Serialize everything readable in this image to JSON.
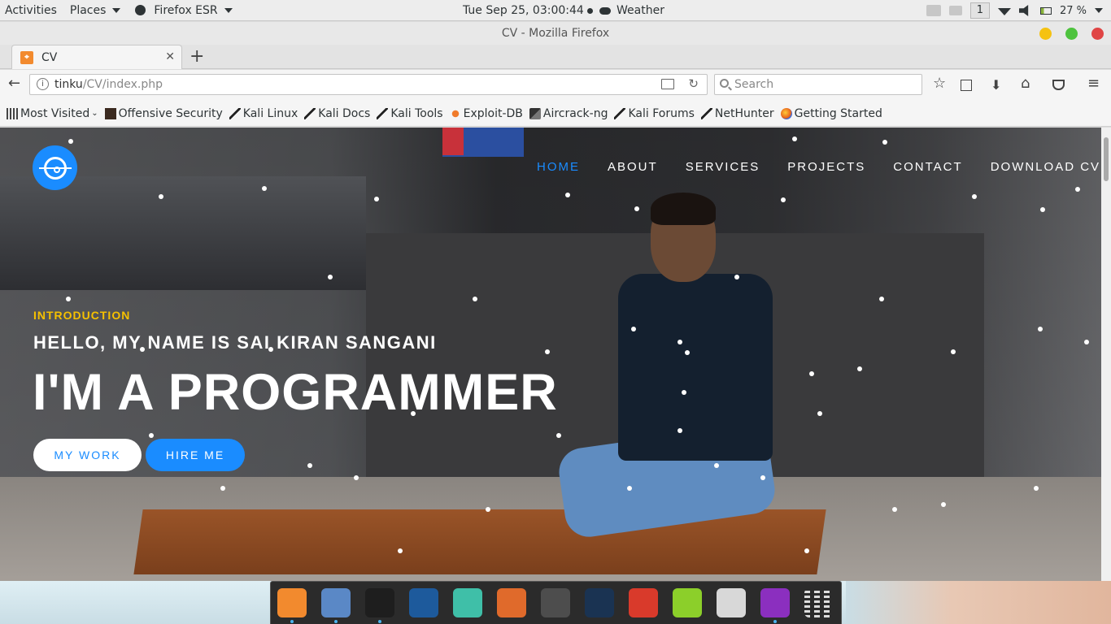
{
  "topbar": {
    "activities": "Activities",
    "places": "Places",
    "app_menu": "Firefox ESR",
    "clock": "Tue Sep 25, 03:00:44",
    "weather": "Weather",
    "workspace": "1",
    "battery": "27 %"
  },
  "window": {
    "title": "CV - Mozilla Firefox"
  },
  "tabs": [
    {
      "label": "CV"
    }
  ],
  "navbar": {
    "url_host": "tinku",
    "url_path": "/CV/index.php",
    "search_placeholder": "Search"
  },
  "bookmarks": [
    {
      "label": "Most Visited",
      "icon": "most-visited-icon"
    },
    {
      "label": "Offensive Security",
      "icon": "offsec-icon"
    },
    {
      "label": "Kali Linux",
      "icon": "kali-icon"
    },
    {
      "label": "Kali Docs",
      "icon": "kali-icon"
    },
    {
      "label": "Kali Tools",
      "icon": "kali-icon"
    },
    {
      "label": "Exploit-DB",
      "icon": "exploit-db-icon"
    },
    {
      "label": "Aircrack-ng",
      "icon": "aircrack-icon"
    },
    {
      "label": "Kali Forums",
      "icon": "kali-icon"
    },
    {
      "label": "NetHunter",
      "icon": "kali-icon"
    },
    {
      "label": "Getting Started",
      "icon": "firefox-icon"
    }
  ],
  "site": {
    "nav": [
      "HOME",
      "ABOUT",
      "SERVICES",
      "PROJECTS",
      "CONTACT",
      "DOWNLOAD CV"
    ],
    "active_nav": "HOME",
    "kicker": "INTRODUCTION",
    "hello": "HELLO, MY NAME IS SAI KIRAN SANGANI",
    "title": "I'M A PROGRAMMER",
    "btn_mywork": "MY WORK",
    "btn_hireme": "HIRE ME",
    "accent_color": "#1a8cff",
    "kicker_color": "#f6c000"
  },
  "dock": [
    {
      "name": "firefox-icon",
      "color": "#f28a2e",
      "running": true
    },
    {
      "name": "files-icon",
      "color": "#5a88c6",
      "running": true
    },
    {
      "name": "terminal-icon",
      "color": "#1e1e1e",
      "running": true
    },
    {
      "name": "metasploit-icon",
      "color": "#1d5a9c",
      "running": false
    },
    {
      "name": "armitage-icon",
      "color": "#3fbfa8",
      "running": false
    },
    {
      "name": "burpsuite-icon",
      "color": "#e06a2b",
      "running": false
    },
    {
      "name": "maltego-icon",
      "color": "#4d4d4d",
      "running": false
    },
    {
      "name": "beef-icon",
      "color": "#1a3352",
      "running": false
    },
    {
      "name": "faraday-icon",
      "color": "#d93a2b",
      "running": false
    },
    {
      "name": "leafpad-icon",
      "color": "#8ccf2a",
      "running": false
    },
    {
      "name": "cutycapt-icon",
      "color": "#d8d8d8",
      "running": false
    },
    {
      "name": "phpstorm-icon",
      "color": "#8b2fbf",
      "running": true
    },
    {
      "name": "show-apps-icon",
      "color": "#2b2b2b",
      "running": false
    }
  ]
}
